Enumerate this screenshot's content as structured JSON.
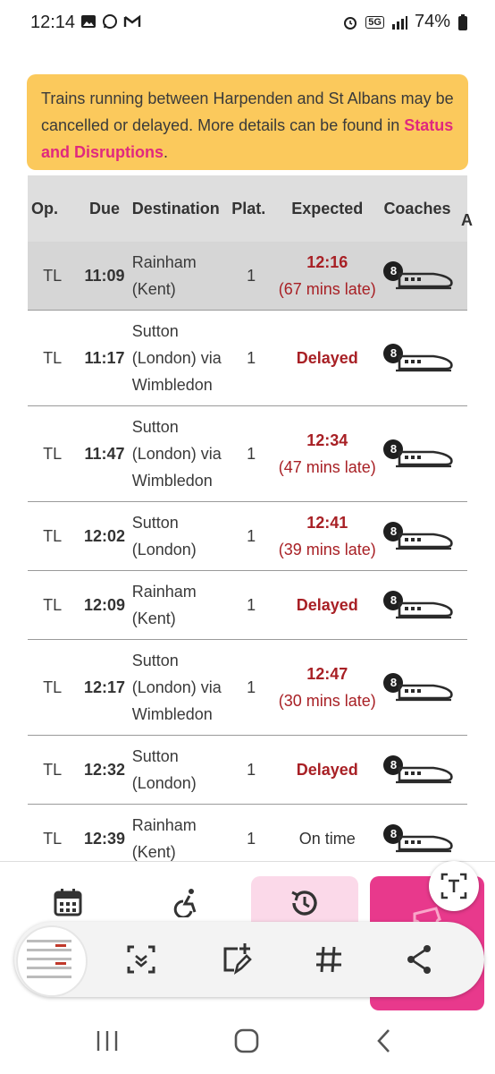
{
  "status_bar": {
    "time": "12:14",
    "battery": "74%",
    "network": "5G"
  },
  "alert": {
    "text": "Trains running between Harpenden and St Albans may be cancelled or delayed. More details can be found in ",
    "link": "Status and Disruptions",
    "suffix": "."
  },
  "table": {
    "headers": {
      "op": "Op.",
      "due": "Due",
      "destination": "Destination",
      "plat": "Plat.",
      "expected": "Expected",
      "coaches": "Coaches",
      "extra": "A"
    },
    "rows": [
      {
        "op": "TL",
        "due": "11:09",
        "dest": [
          "Rainham",
          "(Kent)"
        ],
        "plat": "1",
        "exp_time": "12:16",
        "exp_note": "(67 mins late)",
        "coaches": "8"
      },
      {
        "op": "TL",
        "due": "11:17",
        "dest": [
          "Sutton",
          "(London) via",
          "Wimbledon"
        ],
        "plat": "1",
        "exp_status": "Delayed",
        "coaches": "8"
      },
      {
        "op": "TL",
        "due": "11:47",
        "dest": [
          "Sutton",
          "(London) via",
          "Wimbledon"
        ],
        "plat": "1",
        "exp_time": "12:34",
        "exp_note": "(47 mins late)",
        "coaches": "8"
      },
      {
        "op": "TL",
        "due": "12:02",
        "dest": [
          "Sutton",
          "(London)"
        ],
        "plat": "1",
        "exp_time": "12:41",
        "exp_note": "(39 mins late)",
        "coaches": "8"
      },
      {
        "op": "TL",
        "due": "12:09",
        "dest": [
          "Rainham",
          "(Kent)"
        ],
        "plat": "1",
        "exp_status": "Delayed",
        "coaches": "8"
      },
      {
        "op": "TL",
        "due": "12:17",
        "dest": [
          "Sutton",
          "(London) via",
          "Wimbledon"
        ],
        "plat": "1",
        "exp_time": "12:47",
        "exp_note": "(30 mins late)",
        "coaches": "8"
      },
      {
        "op": "TL",
        "due": "12:32",
        "dest": [
          "Sutton",
          "(London)"
        ],
        "plat": "1",
        "exp_status": "Delayed",
        "coaches": "8"
      },
      {
        "op": "TL",
        "due": "12:39",
        "dest": [
          "Rainham",
          "(Kent)"
        ],
        "plat": "1",
        "exp_ontime": "On time",
        "coaches": "8"
      }
    ]
  },
  "colors": {
    "alert_bg": "#fbc95c",
    "link": "#e0297e",
    "late": "#a82025",
    "nav_active": "#fbd9e9",
    "nav_pink": "#e8398c"
  },
  "icons": {
    "bottom_nav": [
      "calendar-icon",
      "accessibility-icon",
      "history-icon",
      "ticket-icon"
    ],
    "toolbar": [
      "scan-icon",
      "add-edit-icon",
      "hashtag-icon",
      "share-icon"
    ],
    "fab": "text-extract-icon",
    "system_nav": [
      "recents-icon",
      "home-icon",
      "back-icon"
    ]
  }
}
